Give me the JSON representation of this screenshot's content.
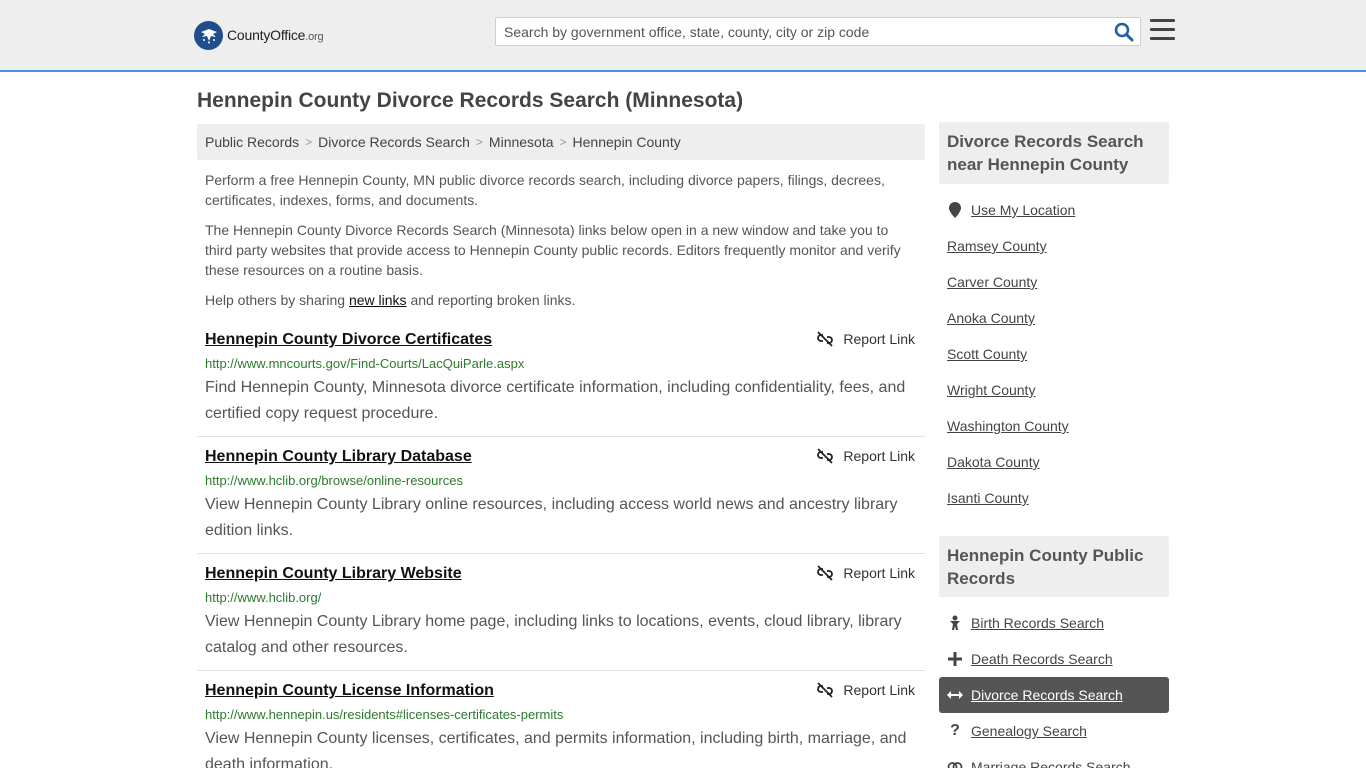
{
  "header": {
    "logo_main": "CountyOffice",
    "logo_org": ".org",
    "search_placeholder": "Search by government office, state, county, city or zip code"
  },
  "page_title": "Hennepin County Divorce Records Search (Minnesota)",
  "breadcrumb": [
    "Public Records",
    "Divorce Records Search",
    "Minnesota",
    "Hennepin County"
  ],
  "intro": {
    "p1": "Perform a free Hennepin County, MN public divorce records search, including divorce papers, filings, decrees, certificates, indexes, forms, and documents.",
    "p2": "The Hennepin County Divorce Records Search (Minnesota) links below open in a new window and take you to third party websites that provide access to Hennepin County public records. Editors frequently monitor and verify these resources on a routine basis.",
    "p3_before": "Help others by sharing ",
    "p3_link": "new links",
    "p3_after": " and reporting broken links."
  },
  "report_label": "Report Link",
  "records": [
    {
      "title": "Hennepin County Divorce Certificates",
      "url": "http://www.mncourts.gov/Find-Courts/LacQuiParle.aspx",
      "desc": "Find Hennepin County, Minnesota divorce certificate information, including confidentiality, fees, and certified copy request procedure."
    },
    {
      "title": "Hennepin County Library Database",
      "url": "http://www.hclib.org/browse/online-resources",
      "desc": "View Hennepin County Library online resources, including access world news and ancestry library edition links."
    },
    {
      "title": "Hennepin County Library Website",
      "url": "http://www.hclib.org/",
      "desc": "View Hennepin County Library home page, including links to locations, events, cloud library, library catalog and other resources."
    },
    {
      "title": "Hennepin County License Information",
      "url": "http://www.hennepin.us/residents#licenses-certificates-permits",
      "desc": "View Hennepin County licenses, certificates, and permits information, including birth, marriage, and death information."
    }
  ],
  "sidebar": {
    "nearby_heading": "Divorce Records Search near Hennepin County",
    "use_location": "Use My Location",
    "nearby": [
      "Ramsey County",
      "Carver County",
      "Anoka County",
      "Scott County",
      "Wright County",
      "Washington County",
      "Dakota County",
      "Isanti County"
    ],
    "public_heading": "Hennepin County Public Records",
    "public_links": [
      {
        "label": "Birth Records Search",
        "icon": "baby-icon"
      },
      {
        "label": "Death Records Search",
        "icon": "cross-icon"
      },
      {
        "label": "Divorce Records Search",
        "icon": "arrows-horizontal-icon",
        "active": true
      },
      {
        "label": "Genealogy Search",
        "icon": "question-icon"
      },
      {
        "label": "Marriage Records Search",
        "icon": "rings-icon"
      }
    ]
  },
  "colors": {
    "header_bg": "#eeeeee",
    "header_border": "#4a90d9",
    "url_green": "#2c7a2c",
    "active_bg": "#555555",
    "logo_blue": "#1f4e8c"
  }
}
